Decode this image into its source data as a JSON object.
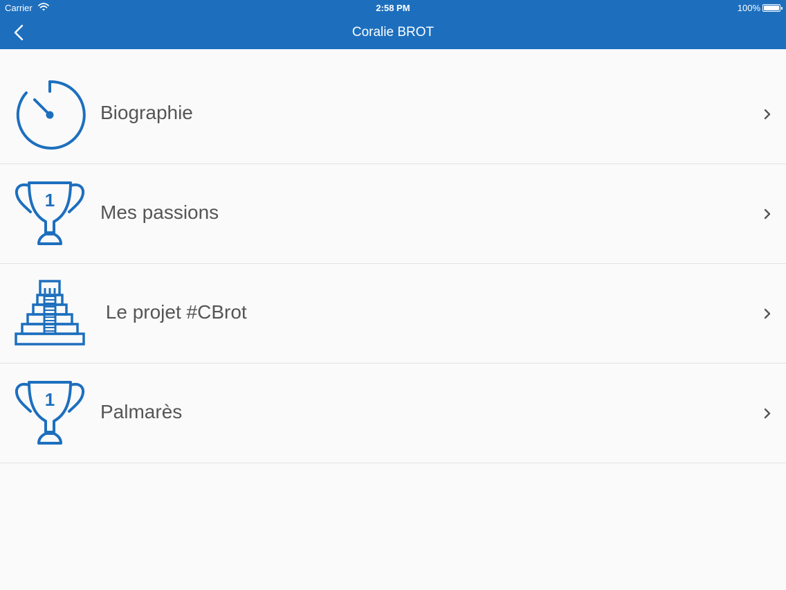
{
  "status_bar": {
    "carrier": "Carrier",
    "time": "2:58 PM",
    "battery": "100%"
  },
  "nav": {
    "title": "Coralie BROT"
  },
  "menu": {
    "items": [
      {
        "label": "Biographie",
        "icon": "stopwatch-icon"
      },
      {
        "label": "Mes passions",
        "icon": "trophy-icon"
      },
      {
        "label": " Le projet #CBrot",
        "icon": "pyramid-icon"
      },
      {
        "label": "Palmarès",
        "icon": "trophy-icon"
      }
    ]
  },
  "colors": {
    "accent": "#1d6fbe",
    "text": "#555555",
    "background": "#fafafa",
    "separator": "#e2e2e2"
  }
}
